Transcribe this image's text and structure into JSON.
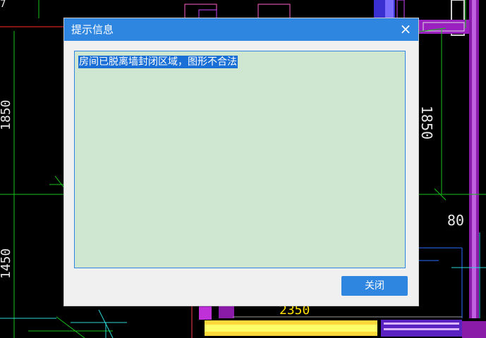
{
  "background": {
    "dim_1850": "1850",
    "dim_1450": "1450",
    "dim_1850_right": "1850",
    "dim_80": "80",
    "dim_2350": "2350",
    "dim_7_top": "7"
  },
  "dialog": {
    "title": "提示信息",
    "close_icon": "×",
    "message": "房间已脱离墙封闭区域，图形不合法",
    "close_button": "关闭"
  },
  "colors": {
    "titlebar": "#2f86e0",
    "message_background": "#cfe7d0",
    "selection": "#1a6fd6"
  }
}
